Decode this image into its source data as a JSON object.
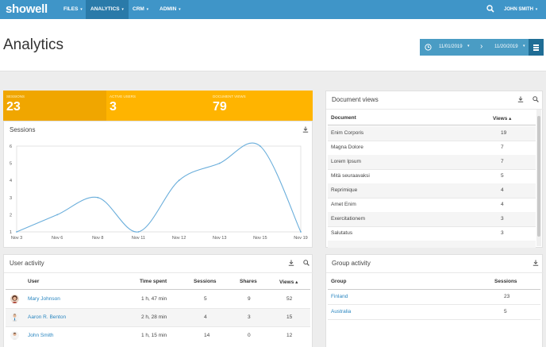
{
  "nav": {
    "logo": "showell",
    "items": [
      {
        "label": "FILES",
        "x": 74,
        "active": false
      },
      {
        "label": "ANALYTICS",
        "x": 108,
        "active": true
      },
      {
        "label": "CRM",
        "x": 161,
        "active": false
      },
      {
        "label": "ADMIN",
        "x": 195,
        "active": false
      }
    ],
    "user": "JOHN SMITH",
    "caret": "▾"
  },
  "header": {
    "title": "Analytics",
    "start_date": "11/01/2019",
    "end_date": "11/20/2019",
    "arrow": "›"
  },
  "stats": [
    {
      "label": "SESSIONS",
      "value": "23"
    },
    {
      "label": "ACTIVE USERS",
      "value": "3"
    },
    {
      "label": "DOCUMENT VIEWS",
      "value": "79"
    }
  ],
  "sessions_panel": {
    "title": "Sessions"
  },
  "chart_data": {
    "type": "line",
    "categories": [
      "Nov 3",
      "Nov 6",
      "Nov 8",
      "Nov 11",
      "Nov 12",
      "Nov 13",
      "Nov 15",
      "Nov 19"
    ],
    "series": [
      {
        "values": [
          1,
          2,
          3,
          1,
          4,
          5,
          6,
          1
        ]
      }
    ],
    "y_ticks": [
      "1",
      "2",
      "3",
      "4",
      "5",
      "6"
    ],
    "ylim": [
      1,
      6
    ],
    "color": "#6aaedb"
  },
  "user_activity": {
    "title": "User activity",
    "headers": {
      "user": "User",
      "time": "Time spent",
      "sessions": "Sessions",
      "shares": "Shares",
      "views": "Views ▴"
    },
    "rows": [
      {
        "user": "Mary Johnson",
        "time": "1 h, 47 min",
        "sessions": "5",
        "shares": "9",
        "views": "52"
      },
      {
        "user": "Aaron R. Benton",
        "time": "2 h, 28 min",
        "sessions": "4",
        "shares": "3",
        "views": "15"
      },
      {
        "user": "John Smith",
        "time": "1 h, 15 min",
        "sessions": "14",
        "shares": "0",
        "views": "12"
      }
    ]
  },
  "document_views": {
    "title": "Document views",
    "headers": {
      "document": "Document",
      "views": "Views ▴"
    },
    "rows": [
      {
        "document": "Enim Corporis",
        "views": "19"
      },
      {
        "document": "Magna Dolore",
        "views": "7"
      },
      {
        "document": "Lorem Ipsum",
        "views": "7"
      },
      {
        "document": "Mitä seuraavaksi",
        "views": "5"
      },
      {
        "document": "Reprimique",
        "views": "4"
      },
      {
        "document": "Amet Enim",
        "views": "4"
      },
      {
        "document": "Exercitationem",
        "views": "3"
      },
      {
        "document": "Salutatus",
        "views": "3"
      }
    ]
  },
  "group_activity": {
    "title": "Group activity",
    "headers": {
      "group": "Group",
      "sessions": "Sessions"
    },
    "rows": [
      {
        "group": "Finland",
        "sessions": "23"
      },
      {
        "group": "Australia",
        "sessions": "5"
      }
    ]
  }
}
